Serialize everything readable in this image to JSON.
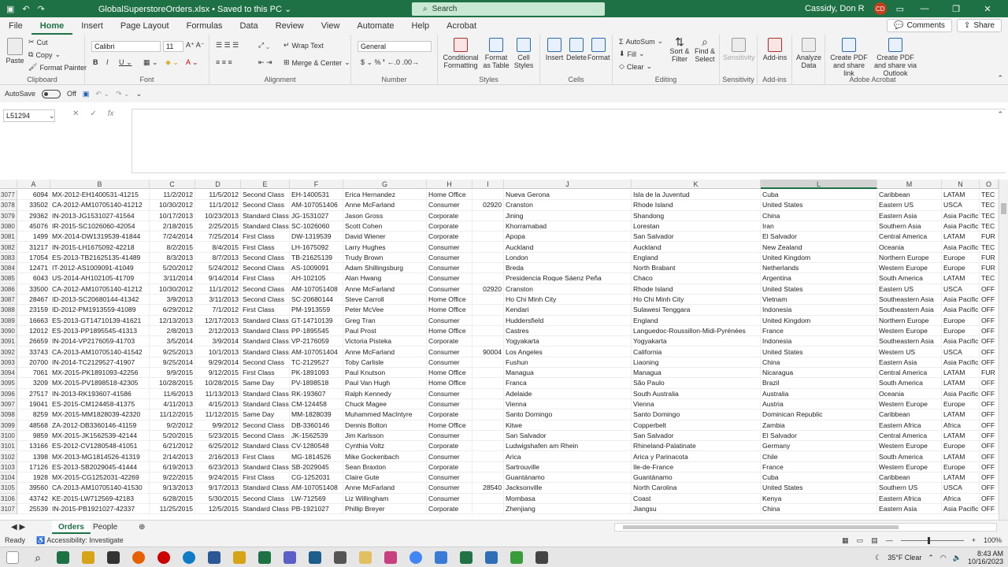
{
  "window": {
    "title": "GlobalSuperstoreOrders.xlsx • Saved to this PC ⌄",
    "search_placeholder": "Search",
    "user": "Cassidy, Don R",
    "user_initials": "CD"
  },
  "tabs": [
    "File",
    "Home",
    "Insert",
    "Page Layout",
    "Formulas",
    "Data",
    "Review",
    "View",
    "Automate",
    "Help",
    "Acrobat"
  ],
  "active_tab": "Home",
  "menu_right": {
    "comments": "Comments",
    "share": "Share"
  },
  "ribbon": {
    "clipboard": {
      "label": "Clipboard",
      "paste": "Paste",
      "cut": "Cut",
      "copy": "Copy",
      "format_painter": "Format Painter"
    },
    "font": {
      "label": "Font",
      "name": "Calibri",
      "size": "11"
    },
    "alignment": {
      "label": "Alignment",
      "wrap": "Wrap Text",
      "merge": "Merge & Center"
    },
    "number": {
      "label": "Number",
      "format": "General"
    },
    "styles": {
      "label": "Styles",
      "conditional": "Conditional Formatting",
      "format_table": "Format as Table",
      "cell_styles": "Cell Styles"
    },
    "cells": {
      "label": "Cells",
      "insert": "Insert",
      "delete": "Delete",
      "format": "Format"
    },
    "editing": {
      "label": "Editing",
      "autosum": "AutoSum",
      "fill": "Fill",
      "clear": "Clear",
      "sort": "Sort & Filter",
      "find": "Find & Select"
    },
    "sensitivity": {
      "label": "Sensitivity",
      "btn": "Sensitivity"
    },
    "addins": {
      "label": "Add-ins",
      "btn": "Add-ins"
    },
    "analyze": {
      "btn": "Analyze Data"
    },
    "acrobat": {
      "label": "Adobe Acrobat",
      "pdf_link": "Create PDF and share link",
      "pdf_outlook": "Create PDF and share via Outlook"
    }
  },
  "qabar": {
    "autosave": "AutoSave",
    "autosave_state": "Off"
  },
  "formula": {
    "namebox": "L51294",
    "fx": "fx"
  },
  "columns": [
    {
      "letter": "A"
    },
    {
      "letter": "B"
    },
    {
      "letter": "C"
    },
    {
      "letter": "D"
    },
    {
      "letter": "E"
    },
    {
      "letter": "F"
    },
    {
      "letter": "G"
    },
    {
      "letter": "H"
    },
    {
      "letter": "I"
    },
    {
      "letter": "J"
    },
    {
      "letter": "K"
    },
    {
      "letter": "L"
    },
    {
      "letter": "M"
    },
    {
      "letter": "N"
    },
    {
      "letter": "O"
    }
  ],
  "rows": [
    {
      "n": "3077",
      "c": [
        "6094",
        "MX-2012-EH1400531-41215",
        "11/2/2012",
        "11/5/2012",
        "Second Class",
        "EH-1400531",
        "Erica Hernandez",
        "Home Office",
        "",
        "Nueva Gerona",
        "Isla de la Juventud",
        "Cuba",
        "Caribbean",
        "LATAM",
        "TEC"
      ]
    },
    {
      "n": "3078",
      "c": [
        "33502",
        "CA-2012-AM10705140-41212",
        "10/30/2012",
        "11/1/2012",
        "Second Class",
        "AM-107051406",
        "Anne McFarland",
        "Consumer",
        "02920",
        "Cranston",
        "Rhode Island",
        "United States",
        "Eastern US",
        "USCA",
        "TEC"
      ]
    },
    {
      "n": "3079",
      "c": [
        "29362",
        "IN-2013-JG1531027-41564",
        "10/17/2013",
        "10/23/2013",
        "Standard Class",
        "JG-1531027",
        "Jason Gross",
        "Corporate",
        "",
        "Jining",
        "Shandong",
        "China",
        "Eastern Asia",
        "Asia Pacific",
        "TEC"
      ]
    },
    {
      "n": "3080",
      "c": [
        "45076",
        "IR-2015-SC1026060-42054",
        "2/18/2015",
        "2/25/2015",
        "Standard Class",
        "SC-1026060",
        "Scott Cohen",
        "Corporate",
        "",
        "Khorramabad",
        "Lorestan",
        "Iran",
        "Southern Asia",
        "Asia Pacific",
        "TEC"
      ]
    },
    {
      "n": "3081",
      "c": [
        "1499",
        "MX-2014-DW1319539-41844",
        "7/24/2014",
        "7/25/2014",
        "First Class",
        "DW-1319539",
        "David Wiener",
        "Corporate",
        "",
        "Apopa",
        "San Salvador",
        "El Salvador",
        "Central America",
        "LATAM",
        "FUR"
      ]
    },
    {
      "n": "3082",
      "c": [
        "31217",
        "IN-2015-LH1675092-42218",
        "8/2/2015",
        "8/4/2015",
        "First Class",
        "LH-1675092",
        "Larry Hughes",
        "Consumer",
        "",
        "Auckland",
        "Auckland",
        "New Zealand",
        "Oceania",
        "Asia Pacific",
        "TEC"
      ]
    },
    {
      "n": "3083",
      "c": [
        "17054",
        "ES-2013-TB21625135-41489",
        "8/3/2013",
        "8/7/2013",
        "Second Class",
        "TB-21625139",
        "Trudy Brown",
        "Consumer",
        "",
        "London",
        "England",
        "United Kingdom",
        "Northern Europe",
        "Europe",
        "FUR"
      ]
    },
    {
      "n": "3084",
      "c": [
        "12471",
        "IT-2012-AS1009091-41049",
        "5/20/2012",
        "5/24/2012",
        "Second Class",
        "AS-1009091",
        "Adam Shillingsburg",
        "Consumer",
        "",
        "Breda",
        "North Brabant",
        "Netherlands",
        "Western Europe",
        "Europe",
        "FUR"
      ]
    },
    {
      "n": "3085",
      "c": [
        "6043",
        "US-2014-AH102105-41709",
        "3/11/2014",
        "9/14/2014",
        "First Class",
        "AH-102105",
        "Alan Hwang",
        "Consumer",
        "",
        "Presidencia Roque Sáenz Peña",
        "Chaco",
        "Argentina",
        "South America",
        "LATAM",
        "TEC"
      ]
    },
    {
      "n": "3086",
      "c": [
        "33500",
        "CA-2012-AM10705140-41212",
        "10/30/2012",
        "11/1/2012",
        "Second Class",
        "AM-107051408",
        "Anne McFarland",
        "Consumer",
        "02920",
        "Cranston",
        "Rhode Island",
        "United States",
        "Eastern US",
        "USCA",
        "OFF"
      ]
    },
    {
      "n": "3087",
      "c": [
        "28467",
        "ID-2013-SC20680144-41342",
        "3/9/2013",
        "3/11/2013",
        "Second Class",
        "SC-20680144",
        "Steve Carroll",
        "Home Office",
        "",
        "Ho Chi Minh City",
        "Ho Chi Minh City",
        "Vietnam",
        "Southeastern Asia",
        "Asia Pacific",
        "OFF"
      ]
    },
    {
      "n": "3088",
      "c": [
        "23159",
        "ID-2012-PM1913559-41089",
        "6/29/2012",
        "7/1/2012",
        "First Class",
        "PM-1913559",
        "Peter McVee",
        "Home Office",
        "",
        "Kendari",
        "Sulawesi Tenggara",
        "Indonesia",
        "Southeastern Asia",
        "Asia Pacific",
        "OFF"
      ]
    },
    {
      "n": "3089",
      "c": [
        "16663",
        "ES-2013-GT14710139-41621",
        "12/13/2013",
        "12/17/2013",
        "Standard Class",
        "GT-14710139",
        "Greg Tran",
        "Consumer",
        "",
        "Huddersfield",
        "England",
        "United Kingdom",
        "Northern Europe",
        "Europe",
        "OFF"
      ]
    },
    {
      "n": "3090",
      "c": [
        "12012",
        "ES-2013-PP1895545-41313",
        "2/8/2013",
        "2/12/2013",
        "Standard Class",
        "PP-1895545",
        "Paul Prost",
        "Home Office",
        "",
        "Castres",
        "Languedoc-Roussillon-Midi-Pyrénées",
        "France",
        "Western Europe",
        "Europe",
        "OFF"
      ]
    },
    {
      "n": "3091",
      "c": [
        "26659",
        "IN-2014-VP2176059-41703",
        "3/5/2014",
        "3/9/2014",
        "Standard Class",
        "VP-2176059",
        "Victoria Pisteka",
        "Corporate",
        "",
        "Yogyakarta",
        "Yogyakarta",
        "Indonesia",
        "Southeastern Asia",
        "Asia Pacific",
        "OFF"
      ]
    },
    {
      "n": "3092",
      "c": [
        "33743",
        "CA-2013-AM10705140-41542",
        "9/25/2013",
        "10/1/2013",
        "Standard Class",
        "AM-107051404",
        "Anne McFarland",
        "Consumer",
        "90004",
        "Los Angeles",
        "California",
        "United States",
        "Western US",
        "USCA",
        "OFF"
      ]
    },
    {
      "n": "3093",
      "c": [
        "20700",
        "IN-2014-TC2129527-41907",
        "9/25/2014",
        "9/29/2014",
        "Second Class",
        "TC-2129527",
        "Toby Carlisle",
        "Consumer",
        "",
        "Fushun",
        "Liaoning",
        "China",
        "Eastern Asia",
        "Asia Pacific",
        "OFF"
      ]
    },
    {
      "n": "3094",
      "c": [
        "7061",
        "MX-2015-PK1891093-42256",
        "9/9/2015",
        "9/12/2015",
        "First Class",
        "PK-1891093",
        "Paul Knutson",
        "Home Office",
        "",
        "Managua",
        "Managua",
        "Nicaragua",
        "Central America",
        "LATAM",
        "FUR"
      ]
    },
    {
      "n": "3095",
      "c": [
        "3209",
        "MX-2015-PV1898518-42305",
        "10/28/2015",
        "10/28/2015",
        "Same Day",
        "PV-1898518",
        "Paul Van Hugh",
        "Home Office",
        "",
        "Franca",
        "São Paulo",
        "Brazil",
        "South America",
        "LATAM",
        "OFF"
      ]
    },
    {
      "n": "3096",
      "c": [
        "27517",
        "IN-2013-RK193607-41586",
        "11/6/2013",
        "11/13/2013",
        "Standard Class",
        "RK-193607",
        "Ralph Kennedy",
        "Consumer",
        "",
        "Adelaide",
        "South Australia",
        "Australia",
        "Oceania",
        "Asia Pacific",
        "OFF"
      ]
    },
    {
      "n": "3097",
      "c": [
        "19041",
        "ES-2015-CM124458-41375",
        "4/11/2013",
        "4/15/2013",
        "Standard Class",
        "CM-124458",
        "Chuck Magee",
        "Consumer",
        "",
        "Vienna",
        "Vienna",
        "Austria",
        "Western Europe",
        "Europe",
        "OFF"
      ]
    },
    {
      "n": "3098",
      "c": [
        "8259",
        "MX-2015-MM1828039-42320",
        "11/12/2015",
        "11/12/2015",
        "Same Day",
        "MM-1828039",
        "Muhammed MacIntyre",
        "Corporate",
        "",
        "Santo Domingo",
        "Santo Domingo",
        "Dominican Republic",
        "Caribbean",
        "LATAM",
        "OFF"
      ]
    },
    {
      "n": "3099",
      "c": [
        "48568",
        "ZA-2012-DB3360146-41159",
        "9/2/2012",
        "9/9/2012",
        "Second Class",
        "DB-3360146",
        "Dennis Bolton",
        "Home Office",
        "",
        "Kitwe",
        "Copperbelt",
        "Zambia",
        "Eastern Africa",
        "Africa",
        "OFF"
      ]
    },
    {
      "n": "3100",
      "c": [
        "9859",
        "MX-2015-JK1562539-42144",
        "5/20/2015",
        "5/23/2015",
        "Second Class",
        "JK-1562539",
        "Jim Karlsson",
        "Consumer",
        "",
        "San Salvador",
        "San Salvador",
        "El Salvador",
        "Central America",
        "LATAM",
        "OFF"
      ]
    },
    {
      "n": "3101",
      "c": [
        "13166",
        "ES-2012-CV1280548-41051",
        "6/21/2012",
        "6/25/2012",
        "Standard Class",
        "CV-1280548",
        "Cynthia Voltz",
        "Corporate",
        "",
        "Ludwigshafen am Rhein",
        "Rhineland-Palatinate",
        "Germany",
        "Western Europe",
        "Europe",
        "OFF"
      ]
    },
    {
      "n": "3102",
      "c": [
        "1398",
        "MX-2013-MG1814526-41319",
        "2/14/2013",
        "2/16/2013",
        "First Class",
        "MG-1814526",
        "Mike Gockenbach",
        "Consumer",
        "",
        "Arica",
        "Arica y Parinacota",
        "Chile",
        "South America",
        "LATAM",
        "OFF"
      ]
    },
    {
      "n": "3103",
      "c": [
        "17126",
        "ES-2013-SB2029045-41444",
        "6/19/2013",
        "6/23/2013",
        "Standard Class",
        "SB-2029045",
        "Sean Braxton",
        "Corporate",
        "",
        "Sartrouville",
        "Ile-de-France",
        "France",
        "Western Europe",
        "Europe",
        "OFF"
      ]
    },
    {
      "n": "3104",
      "c": [
        "1928",
        "MX-2015-CG1252031-42269",
        "9/22/2015",
        "9/24/2015",
        "First Class",
        "CG-1252031",
        "Claire Gute",
        "Consumer",
        "",
        "Guantánamo",
        "Guantánamo",
        "Cuba",
        "Caribbean",
        "LATAM",
        "OFF"
      ]
    },
    {
      "n": "3105",
      "c": [
        "39560",
        "CA-2013-AM10705140-41530",
        "9/13/2013",
        "9/17/2013",
        "Standard Class",
        "AM-107051408",
        "Anne McFarland",
        "Consumer",
        "28540",
        "Jacksonville",
        "North Carolina",
        "United States",
        "Southern US",
        "USCA",
        "OFF"
      ]
    },
    {
      "n": "3106",
      "c": [
        "43742",
        "KE-2015-LW712569-42183",
        "6/28/2015",
        "5/30/2015",
        "Second Class",
        "LW-712569",
        "Liz Willingham",
        "Consumer",
        "",
        "Mombasa",
        "Coast",
        "Kenya",
        "Eastern Africa",
        "Africa",
        "OFF"
      ]
    },
    {
      "n": "3107",
      "c": [
        "25539",
        "IN-2015-PB1921027-42337",
        "11/25/2015",
        "12/5/2015",
        "Standard Class",
        "PB-1921027",
        "Phillip Breyer",
        "Corporate",
        "",
        "Zhenjiang",
        "Jiangsu",
        "China",
        "Eastern Asia",
        "Asia Pacific",
        "OFF"
      ]
    }
  ],
  "sheets": [
    "Orders",
    "People"
  ],
  "active_sheet": "Orders",
  "status": {
    "ready": "Ready",
    "accessibility": "Accessibility: Investigate",
    "zoom": "100%"
  },
  "taskbar": {
    "weather": "35°F  Clear",
    "time": "8:43 AM",
    "date": "10/16/2023"
  }
}
